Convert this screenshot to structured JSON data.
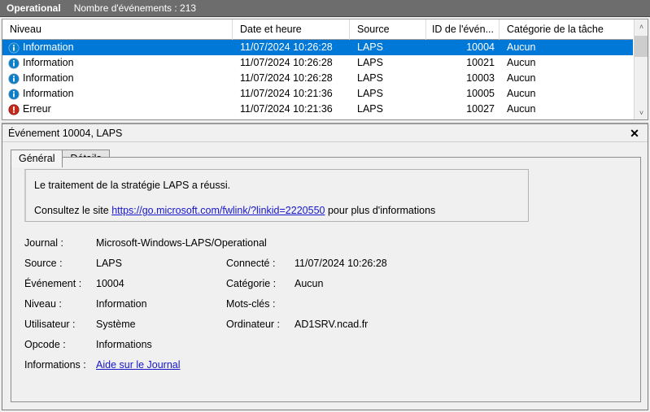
{
  "log_header": {
    "log_name": "Operational",
    "event_count_label": "Nombre d'événements : 213"
  },
  "columns": [
    {
      "key": "niveau",
      "label": "Niveau"
    },
    {
      "key": "date",
      "label": "Date et heure"
    },
    {
      "key": "source",
      "label": "Source"
    },
    {
      "key": "id",
      "label": "ID de l'évén..."
    },
    {
      "key": "cat",
      "label": "Catégorie de la tâche"
    }
  ],
  "rows": [
    {
      "icon": "information-icon",
      "niveau": "Information",
      "date": "11/07/2024 10:26:28",
      "source": "LAPS",
      "id": "10004",
      "cat": "Aucun",
      "selected": true
    },
    {
      "icon": "information-icon",
      "niveau": "Information",
      "date": "11/07/2024 10:26:28",
      "source": "LAPS",
      "id": "10021",
      "cat": "Aucun",
      "selected": false
    },
    {
      "icon": "information-icon",
      "niveau": "Information",
      "date": "11/07/2024 10:26:28",
      "source": "LAPS",
      "id": "10003",
      "cat": "Aucun",
      "selected": false
    },
    {
      "icon": "information-icon",
      "niveau": "Information",
      "date": "11/07/2024 10:21:36",
      "source": "LAPS",
      "id": "10005",
      "cat": "Aucun",
      "selected": false
    },
    {
      "icon": "error-icon",
      "niveau": "Erreur",
      "date": "11/07/2024 10:21:36",
      "source": "LAPS",
      "id": "10027",
      "cat": "Aucun",
      "selected": false
    }
  ],
  "scrollbar": {
    "up_arrow": "˄",
    "down_arrow": "˅"
  },
  "detail": {
    "title": "Événement 10004, LAPS",
    "close_label": "✕",
    "tabs": [
      {
        "label": "Général",
        "active": true
      },
      {
        "label": "Détails",
        "active": false
      }
    ],
    "message": {
      "line1": "Le traitement de la stratégie LAPS a réussi.",
      "line2_prefix": "Consultez le site ",
      "link_text": "https://go.microsoft.com/fwlink/?linkid=2220550",
      "line2_suffix": " pour plus d'informations"
    },
    "properties": {
      "journal_label": "Journal :",
      "journal_value": "Microsoft-Windows-LAPS/Operational",
      "source_label": "Source :",
      "source_value": "LAPS",
      "connected_label": "Connecté :",
      "connected_value": "11/07/2024 10:26:28",
      "event_label": "Événement :",
      "event_value": "10004",
      "category_label": "Catégorie :",
      "category_value": "Aucun",
      "level_label": "Niveau :",
      "level_value": "Information",
      "keywords_label": "Mots-clés :",
      "keywords_value": "",
      "user_label": "Utilisateur :",
      "user_value": "Système",
      "computer_label": "Ordinateur :",
      "computer_value": "AD1SRV.ncad.fr",
      "opcode_label": "Opcode :",
      "opcode_value": "Informations",
      "info_label": "Informations :",
      "info_link_text": "Aide sur le Journal"
    }
  },
  "colors": {
    "header_bar": "#6d6d6d",
    "selection_blue": "#0078d7",
    "link_blue": "#1616c8",
    "info_icon": "#0a7ec8",
    "error_icon": "#c42b1c",
    "panel_bg": "#f0f0f0"
  }
}
